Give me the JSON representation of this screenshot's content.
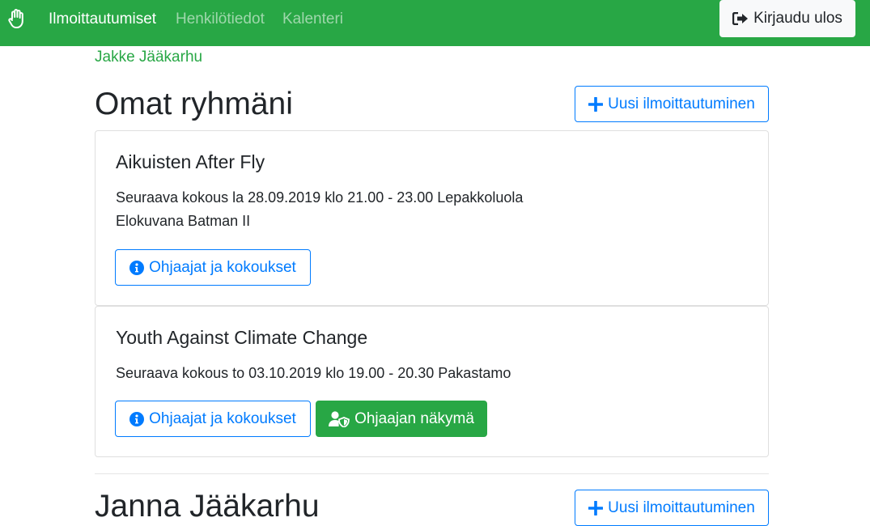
{
  "navbar": {
    "brand_icon": "hand-icon",
    "links": [
      {
        "label": "Ilmoittautumiset",
        "active": true
      },
      {
        "label": "Henkilötiedot",
        "active": false
      },
      {
        "label": "Kalenteri",
        "active": false
      }
    ],
    "logout_label": "Kirjaudu ulos",
    "logout_icon": "sign-out-icon",
    "color": "#28a745"
  },
  "persons": [
    {
      "name": "Jakke Jääkarhu",
      "groups_heading": "Omat ryhmäni",
      "new_registration_label": "Uusi ilmoittautuminen",
      "groups": [
        {
          "title": "Aikuisten After Fly",
          "next_meeting": "Seuraava kokous la 28.09.2019 klo 21.00 - 23.00 Lepakkoluola",
          "note": "Elokuvana Batman II",
          "info_button": "Ohjaajat ja kokoukset"
        },
        {
          "title": "Youth Against Climate Change",
          "next_meeting": "Seuraava kokous to 03.10.2019 klo 19.00 - 20.30 Pakastamo",
          "info_button": "Ohjaajat ja kokoukset",
          "leader_button": "Ohjaajan näkymä"
        }
      ]
    },
    {
      "name": "Janna Jääkarhu",
      "new_registration_label": "Uusi ilmoittautuminen"
    }
  ],
  "colors": {
    "primary": "#007bff",
    "success": "#28a745"
  }
}
